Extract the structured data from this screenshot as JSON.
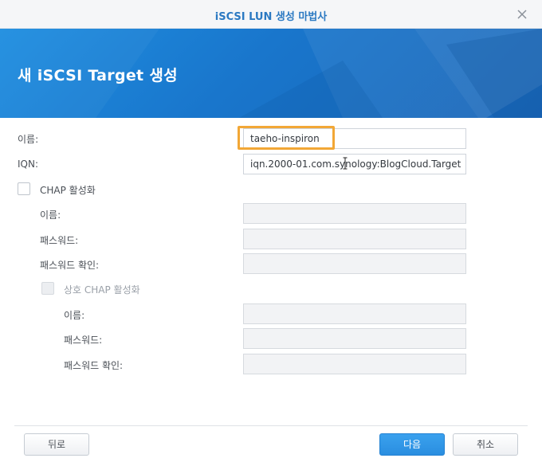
{
  "window": {
    "title": "iSCSI LUN 생성 마법사",
    "close_icon": "close-icon"
  },
  "banner": {
    "heading": "새 iSCSI Target 생성",
    "color": "#1a7ed4"
  },
  "form": {
    "name": {
      "label": "이름:",
      "value": "taeho-inspiron"
    },
    "iqn": {
      "label": "IQN:",
      "value": "iqn.2000-01.com.synology:BlogCloud.Target"
    },
    "chap": {
      "label": "CHAP 활성화",
      "checked": false,
      "name_label": "이름:",
      "password_label": "패스워드:",
      "password_confirm_label": "패스워드 확인:"
    },
    "mutual_chap": {
      "label": "상호 CHAP 활성화",
      "checked": false,
      "name_label": "이름:",
      "password_label": "패스워드:",
      "password_confirm_label": "패스워드 확인:"
    }
  },
  "footer": {
    "back_label": "뒤로",
    "next_label": "다음",
    "cancel_label": "취소"
  },
  "colors": {
    "accent": "#2a8ee0",
    "highlight": "#f2a736"
  }
}
